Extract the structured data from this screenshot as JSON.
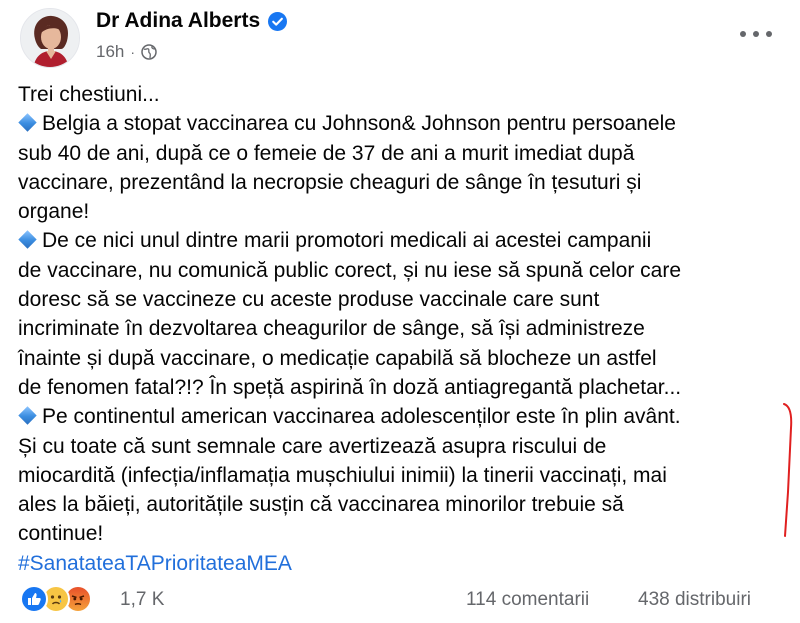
{
  "post": {
    "author": "Dr Adina Alberts",
    "timestamp": "16h",
    "separator": "·",
    "icons": {
      "verified": "verified-badge-icon",
      "audience": "globe-icon",
      "more": "more-options-icon",
      "bullet": "blue-diamond-icon"
    },
    "lines": [
      "Trei chestiuni...",
      "Belgia a stopat vaccinarea cu Johnson& Johnson pentru persoanele",
      "sub 40 de ani, după ce o femeie de 37 de ani a murit imediat după",
      "vaccinare, prezentând la necropsie cheaguri de sânge în țesuturi și",
      "organe!",
      "De ce nici unul dintre marii promotori medicali ai acestei campanii",
      "de vaccinare, nu comunică public corect, și nu iese să spună celor care",
      "doresc să se vaccineze cu aceste produse vaccinale care sunt",
      "incriminate în dezvoltarea cheagurilor de sânge, să își administreze",
      "înainte și după vaccinare, o medicație capabilă să blocheze un astfel",
      "de fenomen fatal?!? În speță aspirină în doză antiagregantă plachetar...",
      "Pe continentul american vaccinarea adolescenților este în plin avânt.",
      "Și cu toate că sunt semnale care avertizează asupra riscului de",
      "miocardită (infecția/inflamația mușchiului inimii) la tinerii vaccinați, mai",
      "ales la băieți, autoritățile susțin că vaccinarea minorilor trebuie să",
      "continue!"
    ],
    "hashtag": "#SanatateaTAPrioritateaMEA",
    "reactions": {
      "types": [
        "like-reaction-icon",
        "sad-reaction-icon",
        "angry-reaction-icon"
      ],
      "count": "1,7 K"
    },
    "comments": "114 comentarii",
    "shares": "438 distribuiri",
    "colors": {
      "accent": "#216fdb",
      "verified": "#1877f2",
      "secondary_text": "#65676b",
      "pen_mark": "#e02020"
    }
  }
}
